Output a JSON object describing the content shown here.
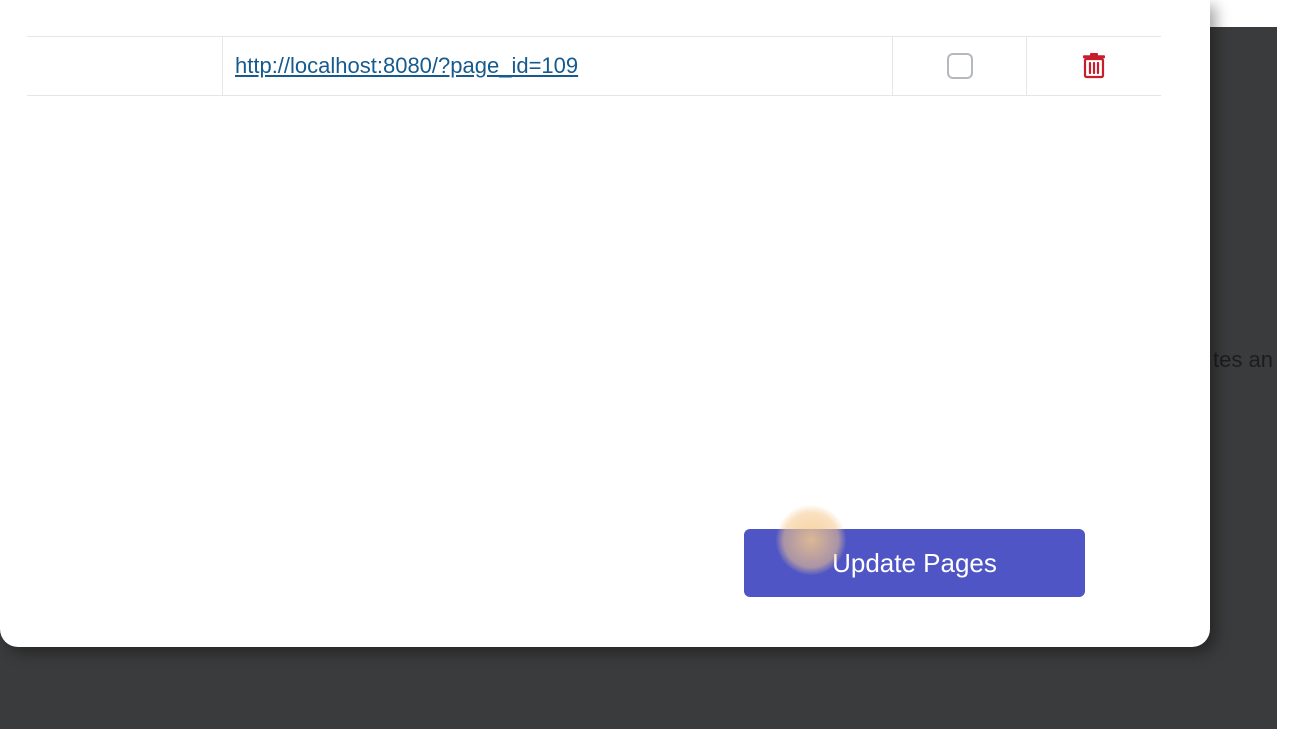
{
  "background": {
    "partial_text": "tes an"
  },
  "table": {
    "rows": [
      {
        "url": "http://localhost:8080/?page_id=109",
        "checked": false
      }
    ]
  },
  "actions": {
    "update_label": "Update Pages"
  },
  "colors": {
    "accent": "#4f55c5",
    "danger": "#c61f2b",
    "link": "#175a8e",
    "backdrop": "#3a3b3c"
  }
}
